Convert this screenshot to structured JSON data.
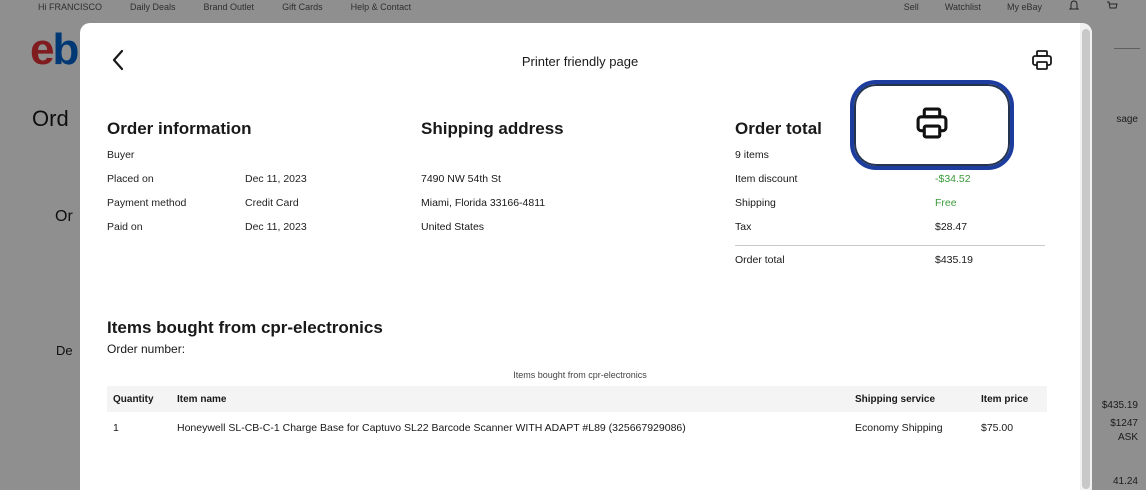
{
  "background": {
    "top_links": [
      "Hi FRANCISCO",
      "Daily Deals",
      "Brand Outlet",
      "Gift Cards",
      "Help & Contact"
    ],
    "top_right": [
      "Sell",
      "Watchlist",
      "My eBay"
    ],
    "logo_e": "e",
    "logo_b": "b",
    "page_title": "Ord",
    "section_or": "Or",
    "section_de": "De",
    "right_texts": [
      "sage",
      "$435.19",
      "$1247",
      "ASK",
      "41.24"
    ]
  },
  "modal": {
    "title": "Printer friendly page",
    "order_info": {
      "heading": "Order information",
      "rows": [
        {
          "k": "Buyer",
          "v": ""
        },
        {
          "k": "Placed on",
          "v": "Dec 11, 2023"
        },
        {
          "k": "Payment method",
          "v": "Credit Card"
        },
        {
          "k": "Paid on",
          "v": "Dec 11, 2023"
        }
      ]
    },
    "shipping": {
      "heading": "Shipping address",
      "lines": [
        "",
        "7490 NW 54th St",
        "Miami, Florida 33166-4811",
        "United States"
      ]
    },
    "order_total": {
      "heading": "Order total",
      "items_label": "9 items",
      "rows": [
        {
          "k": "Item discount",
          "v": "-$34.52"
        },
        {
          "k": "Shipping",
          "v": "Free"
        },
        {
          "k": "Tax",
          "v": "$28.47"
        }
      ],
      "total_label": "Order total",
      "total_value": "$435.19"
    },
    "items": {
      "heading": "Items bought from cpr-electronics",
      "order_number_label": "Order number:",
      "caption": "Items bought from cpr-electronics",
      "columns": [
        "Quantity",
        "Item name",
        "Shipping service",
        "Item price"
      ],
      "rows": [
        {
          "qty": "1",
          "name": "Honeywell SL-CB-C-1 Charge Base for Captuvo SL22 Barcode Scanner WITH ADAPT #L89 (325667929086)",
          "service": "Economy Shipping",
          "price": "$75.00"
        }
      ]
    }
  },
  "icons": {
    "back": "chevron-left-icon",
    "print": "printer-icon"
  },
  "colors": {
    "highlight_border": "#1d3d9e",
    "discount": "#3a9b3a",
    "ebay_red": "#e53238",
    "ebay_blue": "#0064d2"
  }
}
